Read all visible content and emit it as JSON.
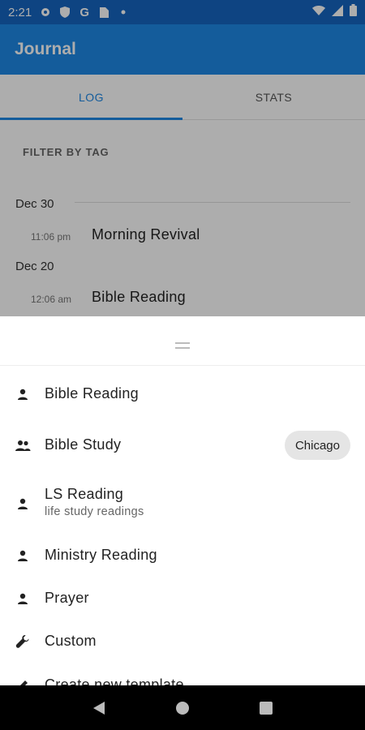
{
  "status_bar": {
    "time": "2:21",
    "left_icons": [
      "gear-icon",
      "shield-icon",
      "google-icon",
      "sim-card-icon",
      "dot-icon"
    ],
    "right_icons": [
      "wifi-icon",
      "signal-icon",
      "battery-icon"
    ]
  },
  "app_bar": {
    "title": "Journal"
  },
  "tabs": [
    {
      "label": "LOG",
      "active": true
    },
    {
      "label": "STATS",
      "active": false
    }
  ],
  "log": {
    "filter_label": "FILTER BY TAG",
    "groups": [
      {
        "date": "Dec 30",
        "entries": [
          {
            "time": "11:06 pm",
            "title": "Morning Revival"
          }
        ]
      },
      {
        "date": "Dec 20",
        "entries": [
          {
            "time": "12:06 am",
            "title": "Bible Reading"
          }
        ]
      }
    ]
  },
  "sheet": {
    "items": [
      {
        "icon": "person-icon",
        "label": "Bible Reading"
      },
      {
        "icon": "group-icon",
        "label": "Bible Study",
        "chip": "Chicago"
      },
      {
        "icon": "person-icon",
        "label": "LS Reading",
        "subtitle": "life study readings"
      },
      {
        "icon": "person-icon",
        "label": "Ministry Reading"
      },
      {
        "icon": "person-icon",
        "label": "Prayer"
      },
      {
        "icon": "wrench-icon",
        "label": "Custom"
      },
      {
        "icon": "edit-icon",
        "label": "Create new template"
      }
    ]
  },
  "nav_bar": {
    "buttons": [
      "back-icon",
      "home-icon",
      "recents-icon"
    ]
  },
  "colors": {
    "primary": "#1e88e5",
    "primary_dark": "#1565c0",
    "scrim": "rgba(0,0,0,0.32)"
  }
}
